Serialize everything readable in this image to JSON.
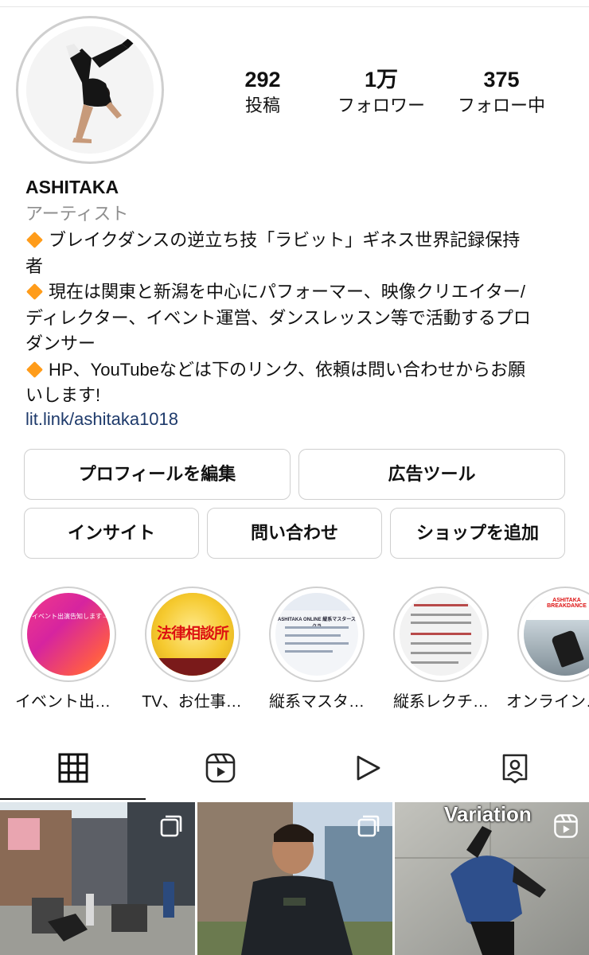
{
  "profile": {
    "username": "ASHITAKA",
    "category": "アーティスト",
    "bio_lines": [
      "ブレイクダンスの逆立ち技「ラビット」ギネス世界記録保持",
      "者",
      "現在は関東と新潟を中心にパフォーマー、映像クリエイター/",
      "ディレクター、イベント運営、ダンスレッスン等で活動するプロ",
      "ダンサー",
      "HP、YouTubeなどは下のリンク、依頼は問い合わせからお願",
      "いします!"
    ],
    "link": "lit.link/ashitaka1018"
  },
  "stats": [
    {
      "value": "292",
      "label": "投稿"
    },
    {
      "value": "1万",
      "label": "フォロワー"
    },
    {
      "value": "375",
      "label": "フォロー中"
    }
  ],
  "buttons": {
    "edit_profile": "プロフィールを編集",
    "ad_tools": "広告ツール",
    "insights": "インサイト",
    "contact": "問い合わせ",
    "add_shop": "ショップを追加"
  },
  "highlights": [
    {
      "caption": "イベント出…",
      "cover_text": "イベント出演告知します→"
    },
    {
      "caption": "TV、お仕事…",
      "cover_text": "法律相談所"
    },
    {
      "caption": "縦系マスタ…",
      "cover_text": "ASHITAKA ONLINE 縦系マスターズクラ"
    },
    {
      "caption": "縦系レクチ…",
      "cover_text": ""
    },
    {
      "caption": "オンライン…",
      "cover_text": "ASHITAKA BREAKDANCE"
    }
  ],
  "tabs": [
    {
      "icon": "grid-icon",
      "active": true
    },
    {
      "icon": "reels-icon",
      "active": false
    },
    {
      "icon": "play-icon",
      "active": false
    },
    {
      "icon": "tagged-icon",
      "active": false
    }
  ],
  "posts": [
    {
      "type": "carousel",
      "overlay_text": ""
    },
    {
      "type": "carousel",
      "overlay_text": ""
    },
    {
      "type": "reel",
      "overlay_text": "Variation"
    }
  ],
  "colors": {
    "link": "#1e3a6b",
    "secondary_text": "#8e8e8e",
    "bullet": "#ff9c1a",
    "border": "#cfcfcf"
  }
}
